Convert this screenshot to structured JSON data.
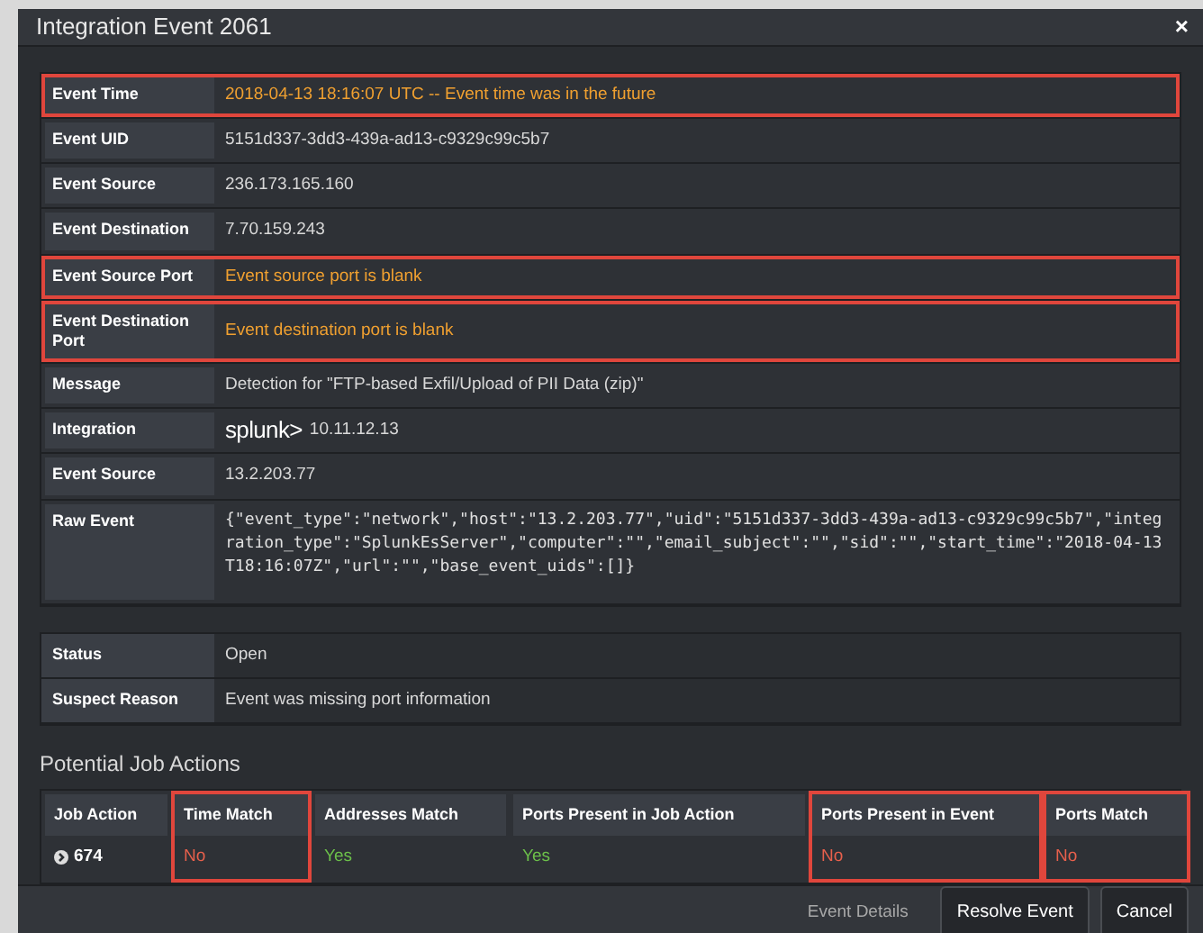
{
  "window": {
    "title": "Integration Event 2061",
    "close": "×"
  },
  "fields": [
    {
      "label": "Event Time",
      "value": "2018-04-13 18:16:07 UTC -- Event time was in the future",
      "kind": "text",
      "color": "#f0a030",
      "highlighted": true
    },
    {
      "label": "Event UID",
      "value": "5151d337-3dd3-439a-ad13-c9329c99c5b7",
      "kind": "text",
      "color": "#d8d8d8",
      "highlighted": false
    },
    {
      "label": "Event Source",
      "value": "236.173.165.160",
      "kind": "text",
      "color": "#d8d8d8",
      "highlighted": false
    },
    {
      "label": "Event Destination",
      "value": "7.70.159.243",
      "kind": "text",
      "color": "#d8d8d8",
      "highlighted": false
    },
    {
      "label": "Event Source Port",
      "value": "Event source port is blank",
      "kind": "text",
      "color": "#f0a030",
      "highlighted": true
    },
    {
      "label": "Event Destination Port",
      "value": "Event destination port is blank",
      "kind": "text",
      "color": "#f0a030",
      "highlighted": true
    },
    {
      "label": "Message",
      "value": "Detection for \"FTP-based Exfil/Upload of PII Data (zip)\"",
      "kind": "text",
      "color": "#d8d8d8",
      "highlighted": false
    },
    {
      "label": "Integration",
      "logo": "splunk>",
      "value": "10.11.12.13",
      "kind": "integration",
      "color": "#d8d8d8",
      "highlighted": false
    },
    {
      "label": "Event Source",
      "value": "13.2.203.77",
      "kind": "text",
      "color": "#d8d8d8",
      "highlighted": false
    },
    {
      "label": "Raw Event",
      "value": "{\"event_type\":\"network\",\"host\":\"13.2.203.77\",\"uid\":\"5151d337-3dd3-439a-ad13-c9329c99c5b7\",\"integration_type\":\"SplunkEsServer\",\"computer\":\"\",\"email_subject\":\"\",\"sid\":\"\",\"start_time\":\"2018-04-13T18:16:07Z\",\"url\":\"\",\"base_event_uids\":[]}",
      "kind": "code",
      "color": "#e0e0e0",
      "highlighted": false
    }
  ],
  "status_fields": [
    {
      "label": "Status",
      "value": "Open"
    },
    {
      "label": "Suspect Reason",
      "value": "Event was missing port information"
    }
  ],
  "job_actions": {
    "title": "Potential Job Actions",
    "columns": [
      {
        "label": "Job Action",
        "highlighted": false
      },
      {
        "label": "Time Match",
        "highlighted": true
      },
      {
        "label": "Addresses Match",
        "highlighted": false
      },
      {
        "label": "Ports Present in Job Action",
        "highlighted": false
      },
      {
        "label": "Ports Present in Event",
        "highlighted": true
      },
      {
        "label": "Ports Match",
        "highlighted": true
      }
    ],
    "rows": [
      [
        {
          "value": "674",
          "color": "#ffffff"
        },
        {
          "value": "No",
          "color": "#e8604c"
        },
        {
          "value": "Yes",
          "color": "#6cc04a"
        },
        {
          "value": "Yes",
          "color": "#6cc04a"
        },
        {
          "value": "No",
          "color": "#e8604c"
        },
        {
          "value": "No",
          "color": "#e8604c"
        }
      ]
    ]
  },
  "footer": {
    "link": "Event Details",
    "buttons": [
      "Resolve Event",
      "Cancel"
    ]
  }
}
